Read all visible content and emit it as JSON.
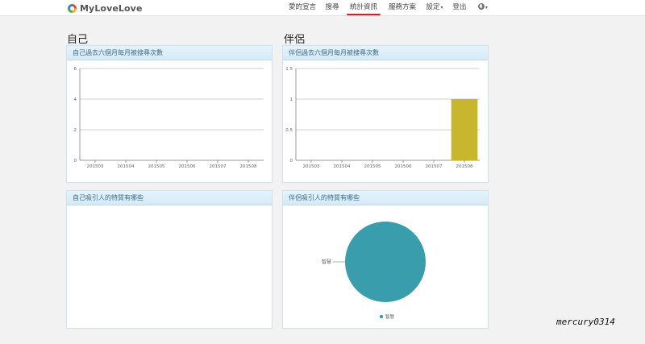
{
  "brand": {
    "name": "MyLoveLove"
  },
  "nav": {
    "items": [
      {
        "label": "愛的宣言"
      },
      {
        "label": "搜尋"
      },
      {
        "label": "統計資訊"
      },
      {
        "label": "服務方案"
      },
      {
        "label": "設定",
        "caret": "▾"
      },
      {
        "label": "登出"
      },
      {
        "caret": "▾"
      }
    ],
    "active_index": 2
  },
  "sections": {
    "self_title": "自己",
    "partner_title": "伴侶"
  },
  "panels": {
    "self_chart_title": "自己過去六個月每月被搜尋次數",
    "partner_chart_title": "伴侶過去六個月每月被搜尋次數",
    "self_traits_title": "自己吸引人的特質有哪些",
    "partner_traits_title": "伴侶吸引人的特質有哪些"
  },
  "chart_data": [
    {
      "type": "bar",
      "categories": [
        "201503",
        "201504",
        "201505",
        "201506",
        "201507",
        "201508"
      ],
      "values": [
        0,
        0,
        0,
        0,
        0,
        0
      ],
      "y_ticks": [
        "0",
        "2",
        "4",
        "6"
      ],
      "ylim": [
        0,
        6
      ],
      "grid": true,
      "bar_color": "#c8b72e"
    },
    {
      "type": "bar",
      "categories": [
        "201503",
        "201504",
        "201505",
        "201506",
        "201507",
        "201508"
      ],
      "values": [
        0,
        0,
        0,
        0,
        0,
        1
      ],
      "y_ticks": [
        "0",
        "0.5",
        "1",
        "1.5"
      ],
      "ylim": [
        0,
        1.5
      ],
      "grid": true,
      "bar_color": "#c8b72e"
    },
    {
      "type": "pie",
      "slices": [
        {
          "label": "智慧",
          "value": 1,
          "color": "#3a9dab"
        }
      ],
      "legend_position": "bottom"
    }
  ],
  "watermark": "mercury0314"
}
